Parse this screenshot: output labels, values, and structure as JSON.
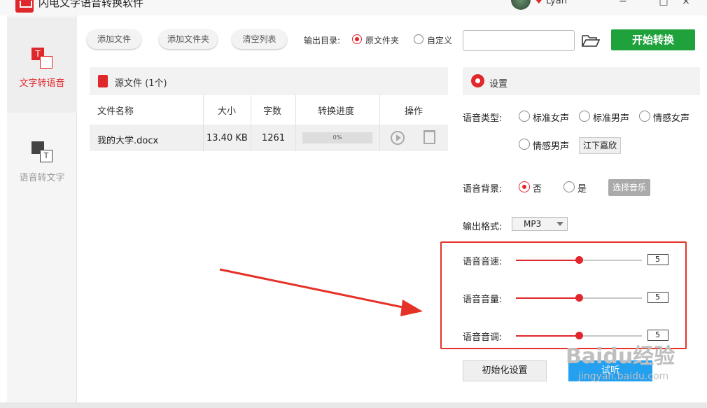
{
  "app": {
    "title": "闪电文字语音转换软件",
    "user": "Lyan",
    "window_controls": [
      "−",
      "□",
      "×"
    ]
  },
  "sidebar": {
    "items": [
      {
        "label": "文字转语音",
        "active": true,
        "icon": "text-to-speech-icon"
      },
      {
        "label": "语音转文字",
        "active": false,
        "icon": "speech-to-text-icon"
      }
    ]
  },
  "toolbar": {
    "add_file": "添加文件",
    "add_folder": "添加文件夹",
    "clear_list": "清空列表",
    "output_dir_label": "输出目录:",
    "output_options": [
      "原文件夹",
      "自定义"
    ],
    "output_selected": "原文件夹",
    "output_path": "",
    "start": "开始转换"
  },
  "file_panel": {
    "title": "源文件 (1个)",
    "columns": [
      "文件名称",
      "大小",
      "字数",
      "转换进度",
      "操作"
    ],
    "rows": [
      {
        "name": "我的大学.docx",
        "size": "13.40 KB",
        "words": "1261",
        "progress": "0%",
        "progress_value": 0
      }
    ]
  },
  "settings": {
    "title": "设置",
    "voice_type_label": "语音类型:",
    "voice_types": [
      "标准女声",
      "标准男声",
      "情感女声",
      "情感男声"
    ],
    "voice_name": "江下嘉欣",
    "background_label": "语音背景:",
    "background_options": [
      "否",
      "是"
    ],
    "background_selected": "否",
    "select_music": "选择音乐",
    "format_label": "输出格式:",
    "format_value": "MP3",
    "sliders": [
      {
        "label": "语音音速:",
        "value": "5",
        "fraction": 0.5
      },
      {
        "label": "语音音量:",
        "value": "5",
        "fraction": 0.5
      },
      {
        "label": "语音音调:",
        "value": "5",
        "fraction": 0.5
      }
    ],
    "reset": "初始化设置",
    "listen": "试听"
  },
  "watermark": {
    "brand": "Baidu经验",
    "url": "jingyan.baidu.com"
  },
  "colors": {
    "accent": "#e0272c",
    "start_button": "#1fa23b",
    "listen_button": "#23a0f0",
    "annotation": "#e53228"
  }
}
